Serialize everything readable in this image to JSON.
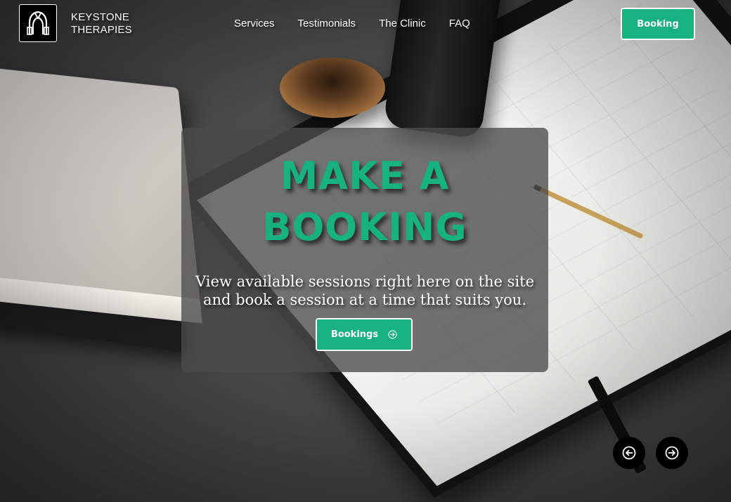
{
  "brand": {
    "line1": "KEYSTONE",
    "line2": "THERAPIES",
    "logo_icon": "arch-logo-icon"
  },
  "nav": {
    "items": [
      {
        "label": "Services"
      },
      {
        "label": "Testimonials"
      },
      {
        "label": "The Clinic"
      },
      {
        "label": "FAQ"
      }
    ]
  },
  "header": {
    "booking_label": "Booking"
  },
  "hero": {
    "title_line1": "MAKE A",
    "title_line2": "BOOKING",
    "subtitle": "View available sessions right here on the site and book a session at a time that suits you.",
    "button_label": "Bookings",
    "button_icon": "arrow-right-circle-icon"
  },
  "slider": {
    "prev_icon": "arrow-left-circle-icon",
    "next_icon": "arrow-right-circle-icon"
  },
  "colors": {
    "accent": "#17b27f",
    "card": "#4b4b4b",
    "control": "#000000"
  }
}
